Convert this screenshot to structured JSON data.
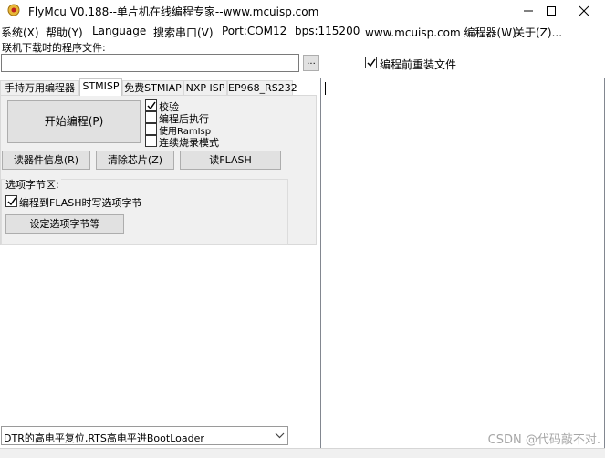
{
  "window": {
    "title": "FlyMcu V0.188--单片机在线编程专家--www.mcuisp.com",
    "icon": "flymcu-app-icon",
    "controls": [
      "minimize-icon",
      "maximize-icon",
      "close-icon"
    ]
  },
  "menu": [
    "系统(X)",
    "帮助(Y)",
    "Language",
    "搜索串口(V)",
    "Port:COM12",
    "bps:115200",
    "www.mcuisp.com 编程器(W)",
    "关于(Z)..."
  ],
  "file": {
    "label": "联机下载时的程序文件:",
    "value": "",
    "browse_label": "...",
    "reload_checked": true,
    "reload_label": "编程前重装文件"
  },
  "tabs": [
    {
      "label": "手持万用编程器",
      "active": false
    },
    {
      "label": "STMISP",
      "active": true
    },
    {
      "label": "免费STMIAP",
      "active": false
    },
    {
      "label": "NXP ISP",
      "active": false
    },
    {
      "label": "EP968_RS232",
      "active": false
    }
  ],
  "stmisp": {
    "start_button": "开始编程(P)",
    "options": [
      {
        "label": "校验",
        "checked": true
      },
      {
        "label": "编程后执行",
        "checked": false
      },
      {
        "label": "使用RamIsp",
        "checked": false
      },
      {
        "label": "连续烧录模式",
        "checked": false
      }
    ],
    "read_info_button": "读器件信息(R)",
    "erase_button": "清除芯片(Z)",
    "read_flash_button": "读FLASH",
    "option_group": {
      "title": "选项字节区:",
      "write_option_checked": true,
      "write_option_label": "编程到FLASH时写选项字节",
      "set_option_button": "设定选项字节等"
    }
  },
  "log": {
    "text": "",
    "watermark": "CSDN @代码敲不对."
  },
  "bootloader": {
    "selected": "DTR的高电平复位,RTS高电平进BootLoader"
  }
}
